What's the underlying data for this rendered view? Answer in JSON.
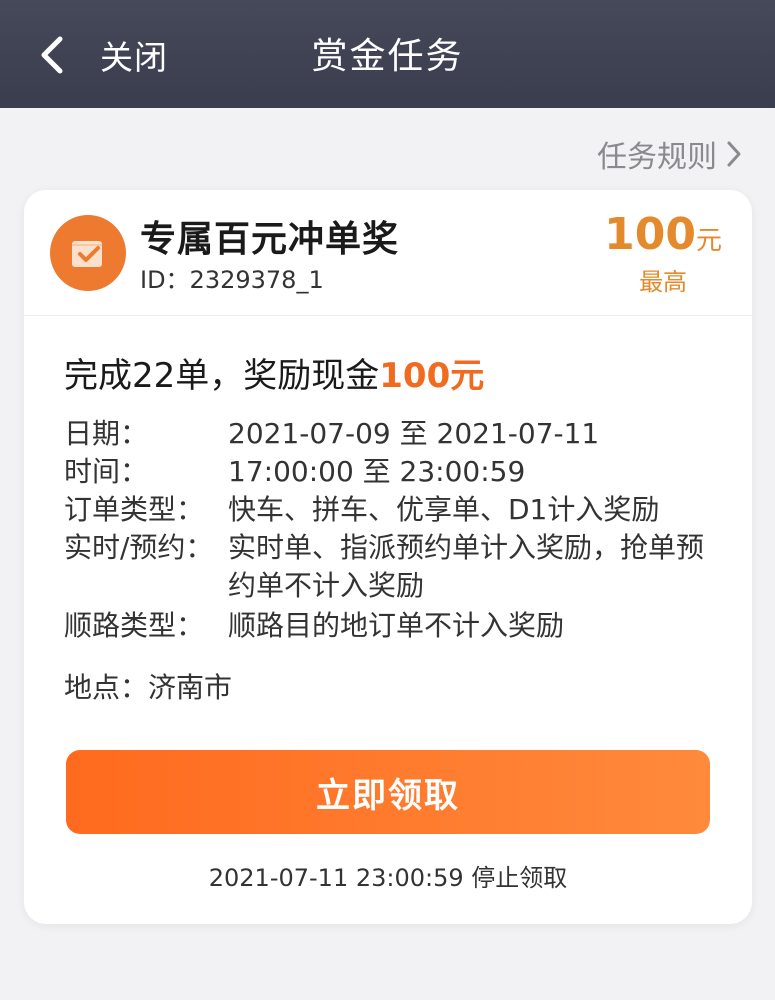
{
  "header": {
    "back_label": "关闭",
    "title": "赏金任务"
  },
  "rules_link": "任务规则",
  "task": {
    "title": "专属百元冲单奖",
    "id": "ID：2329378_1",
    "reward_amount": "100",
    "reward_unit": "元",
    "reward_note": "最高",
    "headline_prefix": "完成22单，奖励现金",
    "headline_amount": "100元",
    "details": [
      {
        "label": "日期：",
        "value": "2021-07-09 至 2021-07-11"
      },
      {
        "label": "时间：",
        "value": "17:00:00 至 23:00:59"
      },
      {
        "label": "订单类型：",
        "value": "快车、拼车、优享单、D1计入奖励"
      },
      {
        "label": "实时/预约：",
        "value": "实时单、指派预约单计入奖励，抢单预约单不计入奖励"
      },
      {
        "label": "顺路类型：",
        "value": "顺路目的地订单不计入奖励"
      }
    ],
    "location": "地点：济南市",
    "claim_button": "立即领取",
    "deadline": "2021-07-11 23:00:59 停止领取"
  },
  "colors": {
    "header_bg": "#3f4253",
    "accent_orange": "#ff6a1e",
    "reward_gold": "#e58a2c"
  },
  "icons": [
    "chevron-left-icon",
    "chevron-right-icon",
    "task-badge-icon"
  ]
}
